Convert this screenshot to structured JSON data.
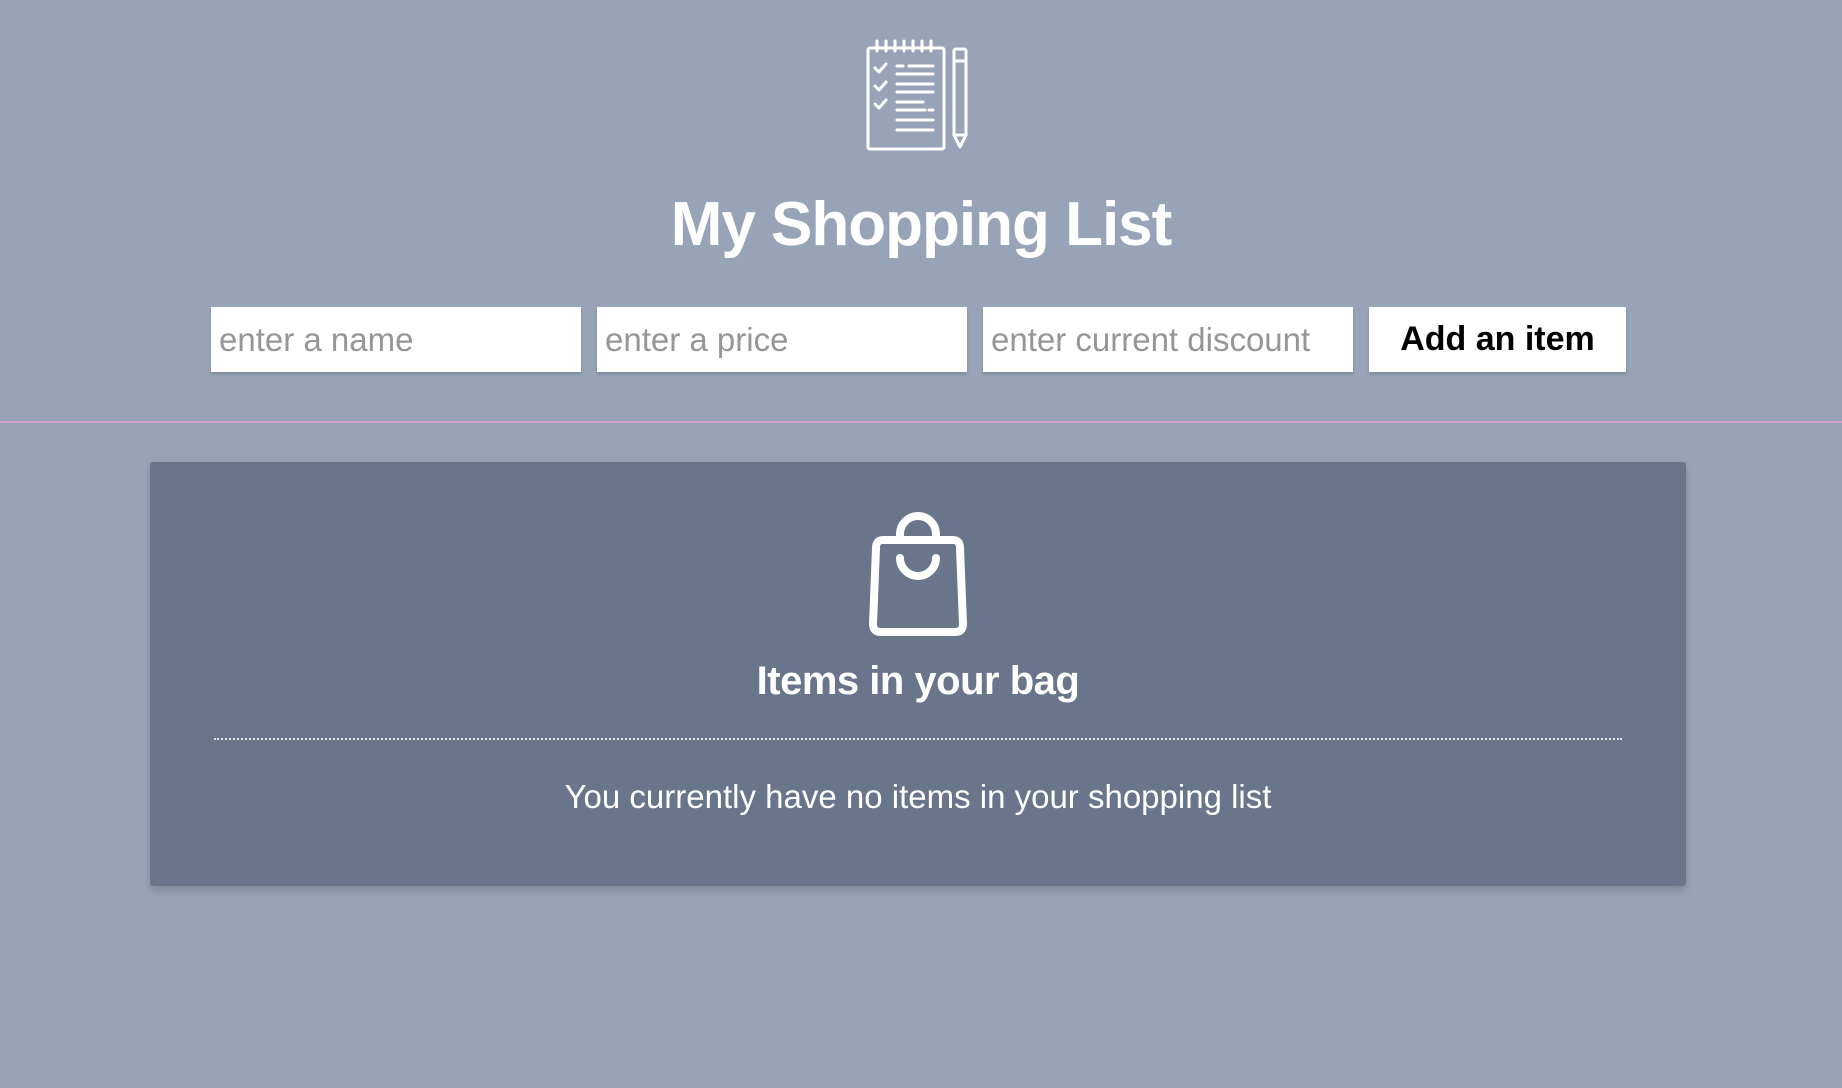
{
  "header": {
    "logo_icon": "notepad-checklist-with-pencil-icon",
    "title": "My Shopping List"
  },
  "form": {
    "name_placeholder": "enter a name",
    "price_placeholder": "enter a price",
    "discount_placeholder": "enter current discount",
    "add_button_label": "Add an item"
  },
  "bag": {
    "icon": "shopping-bag-icon",
    "title": "Items in your bag",
    "empty_message": "You currently have no items in your shopping list"
  },
  "colors": {
    "page_background": "#97a4b7",
    "panel_background": "#68758a",
    "header_divider": "#d9a0cf",
    "text": "#ffffff"
  }
}
